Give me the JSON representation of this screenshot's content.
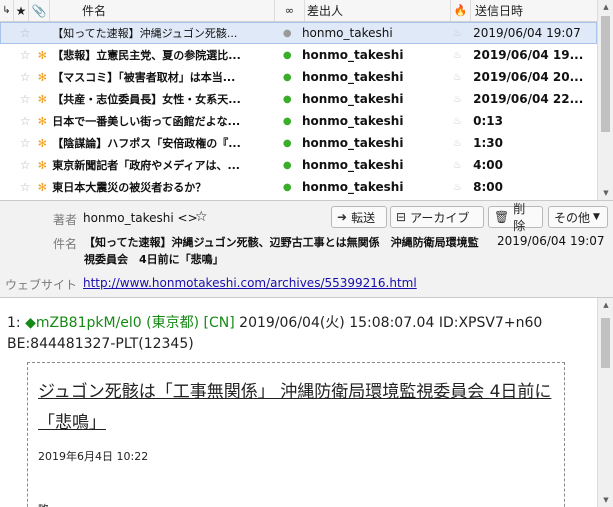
{
  "list": {
    "columns": {
      "thread": "↳",
      "star": "★",
      "attach": "📎",
      "subject": "件名",
      "read": "∞",
      "from": "差出人",
      "junk": "🔥",
      "date": "送信日時"
    },
    "rows": [
      {
        "subject": "【知ってた速報】沖縄ジュゴン死骸...",
        "from": "honmo_takeshi",
        "date": "2019/06/04 19:07",
        "unread": false,
        "selected": true,
        "flag": "",
        "dot": "gray"
      },
      {
        "subject": "【悲報】立憲民主党、夏の参院選比...",
        "from": "honmo_takeshi",
        "date": "2019/06/04 19...",
        "unread": true,
        "selected": false,
        "flag": "✻",
        "dot": "green"
      },
      {
        "subject": "【マスコミ】「被害者取材」は本当...",
        "from": "honmo_takeshi",
        "date": "2019/06/04 20...",
        "unread": true,
        "selected": false,
        "flag": "✻",
        "dot": "green"
      },
      {
        "subject": "【共産・志位委員長】女性・女系天...",
        "from": "honmo_takeshi",
        "date": "2019/06/04 22...",
        "unread": true,
        "selected": false,
        "flag": "✻",
        "dot": "green"
      },
      {
        "subject": "日本で一番美しい街って函館だよな...",
        "from": "honmo_takeshi",
        "date": "0:13",
        "unread": true,
        "selected": false,
        "flag": "✻",
        "dot": "green"
      },
      {
        "subject": "【陰謀論】ハフポス「安倍政権の『...",
        "from": "honmo_takeshi",
        "date": "1:30",
        "unread": true,
        "selected": false,
        "flag": "✻",
        "dot": "green"
      },
      {
        "subject": "東京新聞記者「政府やメディアは、...",
        "from": "honmo_takeshi",
        "date": "4:00",
        "unread": true,
        "selected": false,
        "flag": "✻",
        "dot": "green"
      },
      {
        "subject": "東日本大震災の被災者おるか？",
        "from": "honmo_takeshi",
        "date": "8:00",
        "unread": true,
        "selected": false,
        "flag": "✻",
        "dot": "green"
      }
    ]
  },
  "header": {
    "from_label": "著者",
    "from_value": "honmo_takeshi <>",
    "subject_label": "件名",
    "subject_value": "【知ってた速報】沖縄ジュゴン死骸、辺野古工事とは無関係　沖縄防衛局環境監視委員会　4日前に「悲鳴」",
    "date_value": "2019/06/04 19:07",
    "website_label": "ウェブサイト",
    "website_value": "http://www.honmotakeshi.com/archives/55399216.html",
    "buttons": {
      "forward": "転送",
      "archive": "アーカイブ",
      "delete": "削除",
      "other": "その他"
    }
  },
  "body": {
    "post_num": "1:",
    "post_name": "◆mZB81pkM/el0 (東京都)",
    "post_country": "[CN]",
    "post_date": "2019/06/04(火) 15:08:07.04 ID:XPSV7+n60",
    "post_be": "BE:844481327-PLT(12345)",
    "quote_title": "ジュゴン死骸は「工事無関係」 沖縄防衛局環境監視委員会 4日前に「悲鳴」",
    "quote_date": "2019年6月4日 10:22",
    "quote_tail": "略"
  }
}
